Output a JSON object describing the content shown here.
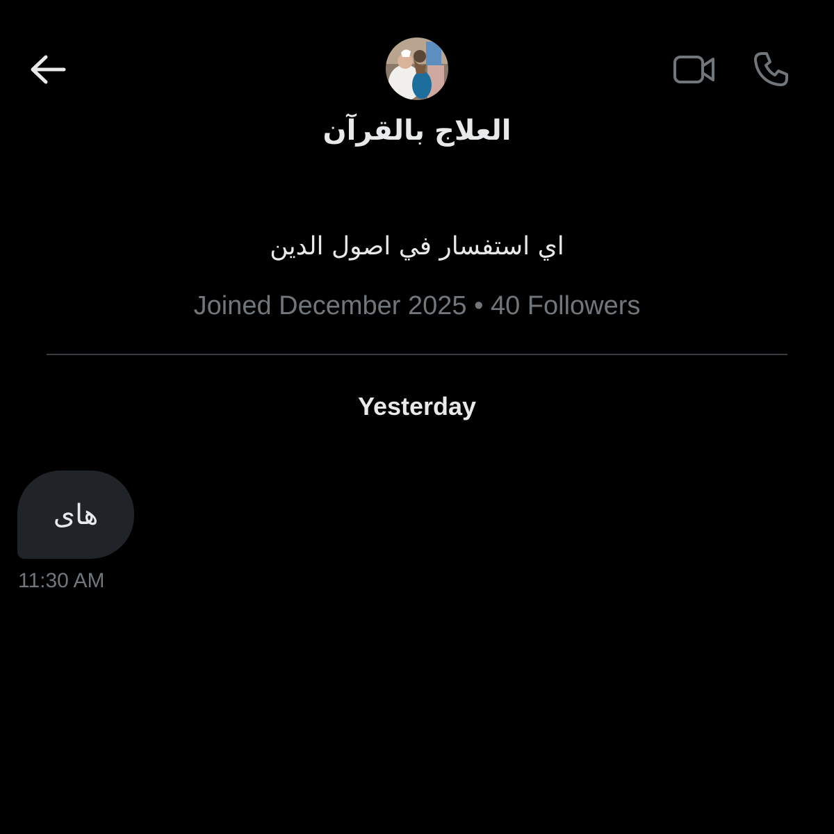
{
  "header": {
    "back_icon": "arrow-left-icon",
    "video_icon": "video-camera-icon",
    "call_icon": "phone-icon",
    "icon_color": "#e7e9ea",
    "secondary_icon_color": "#71767b"
  },
  "profile": {
    "name": "العلاج بالقرآن",
    "bio": "اي استفسار في اصول الدين",
    "joined": "Joined December 2025",
    "separator": "•",
    "followers": "40 Followers"
  },
  "conversation": {
    "date_label": "Yesterday",
    "messages": [
      {
        "text": "هاى",
        "time": "11:30 AM",
        "direction": "incoming"
      }
    ]
  },
  "colors": {
    "background": "#000000",
    "primary_text": "#e7e9ea",
    "secondary_text": "#71767b",
    "bubble": "#202327",
    "divider": "#3a3d42"
  }
}
